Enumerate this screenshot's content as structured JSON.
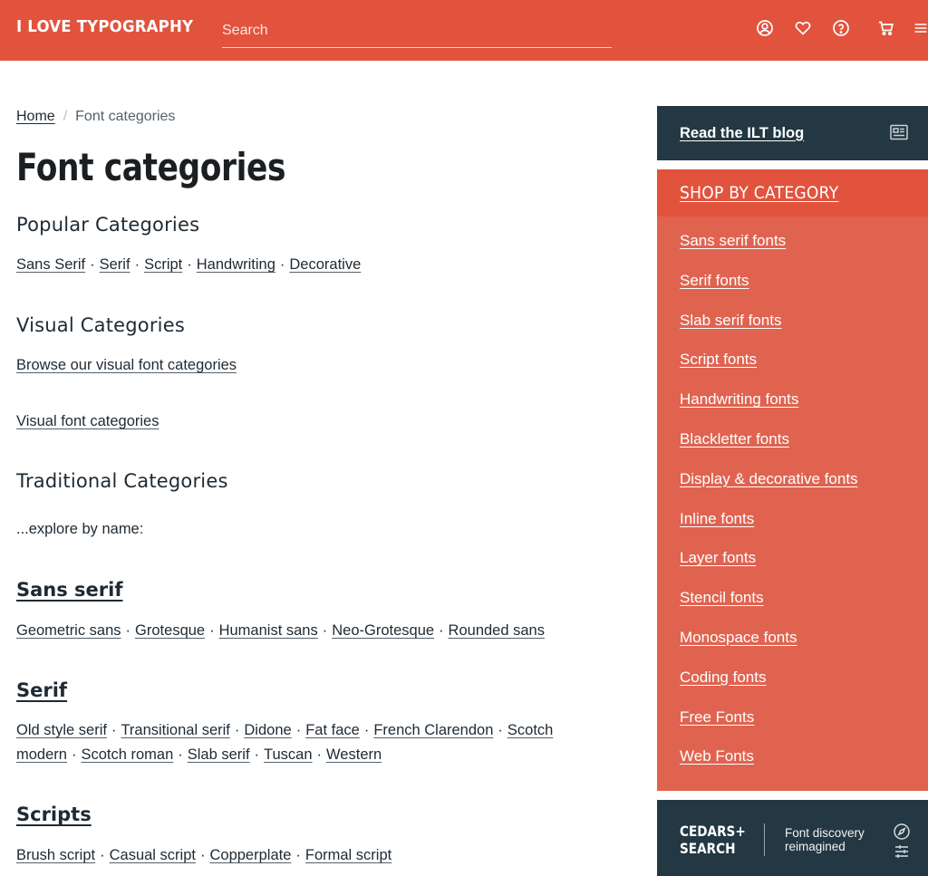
{
  "header": {
    "logo": "I LOVE TYPOGRAPHY",
    "search_placeholder": "Search",
    "icons": [
      "account-icon",
      "heart-icon",
      "help-icon",
      "cart-icon",
      "menu-icon"
    ]
  },
  "breadcrumb": {
    "home": "Home",
    "separator": "/",
    "current": "Font categories"
  },
  "page_title": "Font categories",
  "popular": {
    "heading": "Popular Categories",
    "links": [
      "Sans Serif",
      "Serif",
      "Script",
      "Handwriting",
      "Decorative"
    ]
  },
  "visual": {
    "heading": "Visual Categories",
    "browse_link": "Browse our visual font categories",
    "link": "Visual font categories"
  },
  "traditional": {
    "heading": "Traditional Categories",
    "intro": "...explore by name:"
  },
  "sans_serif": {
    "heading": "Sans serif",
    "links": [
      "Geometric sans",
      "Grotesque",
      "Humanist sans",
      "Neo-Grotesque",
      "Rounded sans"
    ]
  },
  "serif": {
    "heading": "Serif",
    "links": [
      "Old style serif",
      "Transitional serif",
      "Didone",
      "Fat face",
      "French Clarendon",
      "Scotch modern",
      "Scotch roman",
      "Slab serif",
      "Tuscan",
      "Western"
    ]
  },
  "scripts": {
    "heading": "Scripts",
    "links": [
      "Brush script",
      "Casual script",
      "Copperplate",
      "Formal script"
    ]
  },
  "sidebar": {
    "blog_label": "Read the ILT blog",
    "shop_heading": "SHOP BY CATEGORY",
    "categories": [
      "Sans serif fonts",
      "Serif fonts",
      "Slab serif fonts",
      "Script fonts",
      "Handwriting fonts",
      "Blackletter fonts",
      "Display & decorative fonts",
      "Inline fonts",
      "Layer fonts",
      "Stencil fonts",
      "Monospace fonts",
      "Coding fonts",
      "Free Fonts",
      "Web Fonts"
    ],
    "cedars_line1": "CEDARS+",
    "cedars_line2": "SEARCH",
    "cedars_tag_line1": "Font discovery",
    "cedars_tag_line2": "reimagined"
  },
  "colors": {
    "header_bg": "#e1533d",
    "sidebar_bg": "#e06350",
    "dark_bg": "#233842",
    "text": "#1f2a33"
  }
}
